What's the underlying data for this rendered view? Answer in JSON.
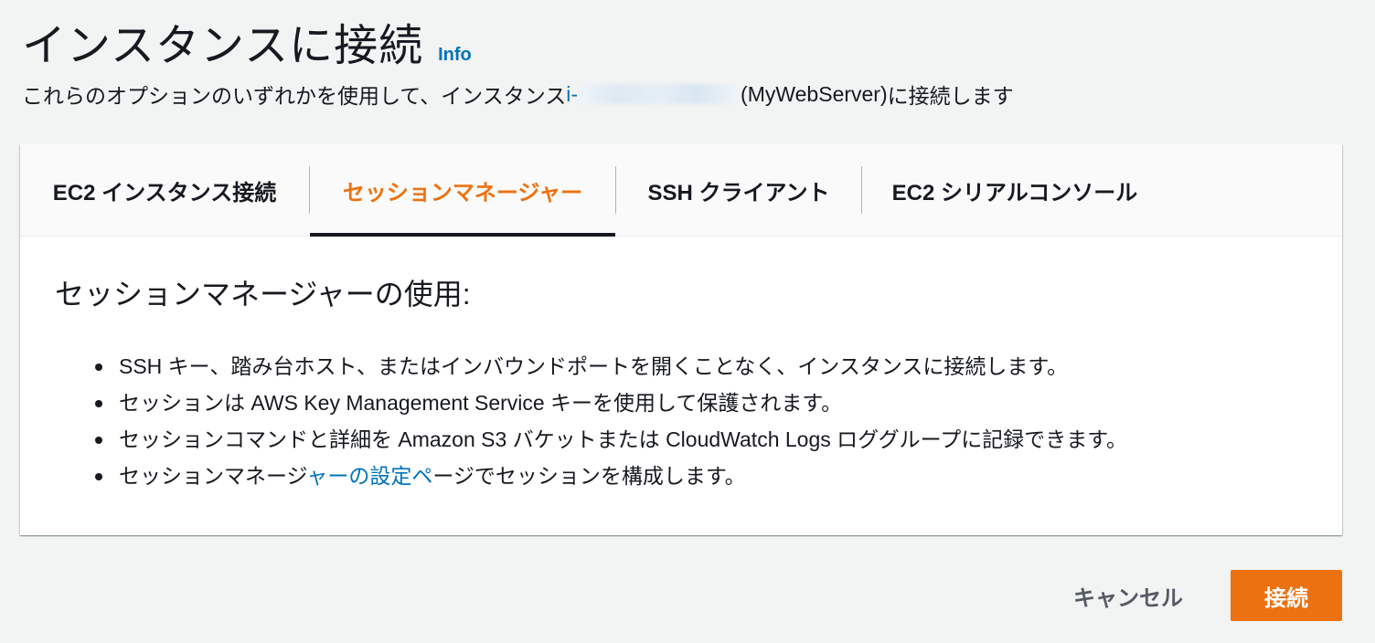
{
  "header": {
    "title": "インスタンスに接続",
    "info_label": "Info"
  },
  "subtitle": {
    "prefix": "これらのオプションのいずれかを使用して、インスタンス ",
    "instance_id_visible": "i-",
    "instance_name": "(MyWebServer)",
    "suffix": " に接続します"
  },
  "tabs": [
    {
      "label": "EC2 インスタンス接続",
      "active": false
    },
    {
      "label": "セッションマネージャー",
      "active": true
    },
    {
      "label": "SSH クライアント",
      "active": false
    },
    {
      "label": "EC2 シリアルコンソール",
      "active": false
    }
  ],
  "panel": {
    "heading": "セッションマネージャーの使用:",
    "bullets": [
      "SSH キー、踏み台ホスト、またはインバウンドポートを開くことなく、インスタンスに接続します。",
      "セッションは AWS Key Management Service キーを使用して保護されます。",
      "セッションコマンドと詳細を Amazon S3 バケットまたは CloudWatch Logs ロググループに記録できます。"
    ],
    "last_bullet": {
      "prefix": "セッションマネージ",
      "link": "ャーの設定ペ",
      "suffix": "ージでセッションを構成します。"
    }
  },
  "footer": {
    "cancel_label": "キャンセル",
    "connect_label": "接続"
  },
  "colors": {
    "accent_orange": "#ec7211",
    "link_blue": "#0073bb",
    "text": "#16191f",
    "background": "#f2f3f3"
  }
}
